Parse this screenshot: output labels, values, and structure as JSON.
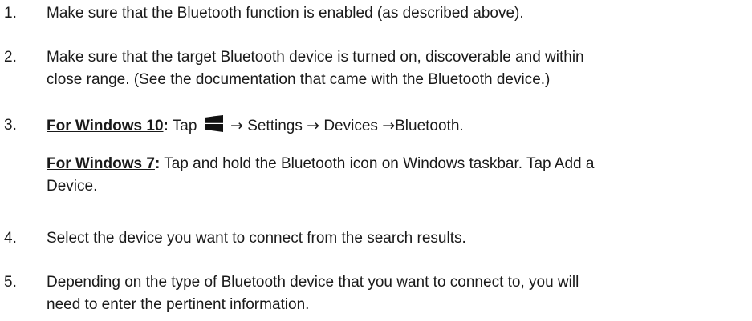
{
  "steps": [
    {
      "number": "1.",
      "text": "Make sure that the Bluetooth function is enabled (as described above)."
    },
    {
      "number": "2.",
      "line1": "Make sure that the target Bluetooth device is turned on, discoverable and within",
      "line2": "close range. (See the documentation that came with the Bluetooth device.)"
    },
    {
      "number": "3.",
      "win10_label": "For Windows 10",
      "win10_colon": ":",
      "win10_tap": "Tap",
      "windows_icon": "windows-logo-icon",
      "arrow": "→",
      "path_settings": "Settings",
      "path_devices": "Devices",
      "path_bluetooth": "Bluetooth.",
      "win7_label": "For Windows 7",
      "win7_colon": ":",
      "win7_line1": "Tap and hold the Bluetooth icon on Windows taskbar. Tap Add a",
      "win7_line2": "Device."
    },
    {
      "number": "4.",
      "text": "Select the device you want to connect from the search results."
    },
    {
      "number": "5.",
      "line1": "Depending on the type of Bluetooth device that you want to connect to, you will",
      "line2": "need to enter the pertinent information."
    }
  ],
  "colors": {
    "text": "#1a1a1a",
    "windows_logo": "#111111"
  }
}
